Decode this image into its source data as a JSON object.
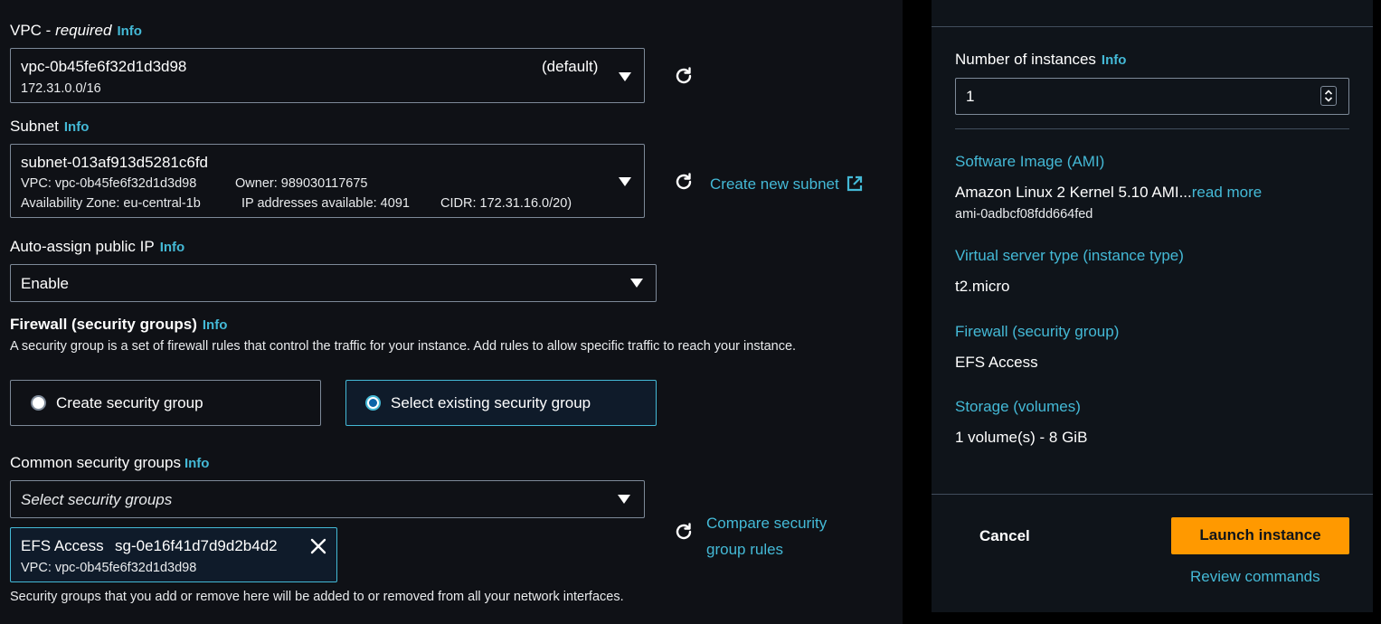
{
  "vpc": {
    "label": "VPC - ",
    "required": "required",
    "info": "Info",
    "value": "vpc-0b45fe6f32d1d3d98",
    "default_tag": "(default)",
    "cidr": "172.31.0.0/16"
  },
  "subnet": {
    "label": "Subnet",
    "info": "Info",
    "value": "subnet-013af913d5281c6fd",
    "vpc_line": "VPC: vpc-0b45fe6f32d1d3d98",
    "owner": "Owner: 989030117675",
    "az": "Availability Zone: eu-central-1b",
    "ips": "IP addresses available: 4091",
    "cidr": "CIDR: 172.31.16.0/20)",
    "create_link": "Create new subnet"
  },
  "auto_ip": {
    "label": "Auto-assign public IP",
    "info": "Info",
    "value": "Enable"
  },
  "firewall": {
    "label": "Firewall (security groups)",
    "info": "Info",
    "description": "A security group is a set of firewall rules that control the traffic for your instance. Add rules to allow specific traffic to reach your instance.",
    "option_create": "Create security group",
    "option_select": "Select existing security group"
  },
  "common_sg": {
    "label": "Common security groups",
    "info": "Info",
    "placeholder": "Select security groups",
    "compare_line1": "Compare security",
    "compare_line2": "group rules",
    "token_name": "EFS Access",
    "token_id": "sg-0e16f41d7d9d2b4d2",
    "token_vpc": "VPC: vpc-0b45fe6f32d1d3d98",
    "footnote": "Security groups that you add or remove here will be added to or removed from all your network interfaces."
  },
  "summary": {
    "instances_label": "Number of instances",
    "instances_info": "Info",
    "instances_value": "1",
    "ami_head": "Software Image (AMI)",
    "ami_value": "Amazon Linux 2 Kernel 5.10 AMI...",
    "ami_read_more": "read more",
    "ami_id": "ami-0adbcf08fdd664fed",
    "type_head": "Virtual server type (instance type)",
    "type_value": "t2.micro",
    "fw_head": "Firewall (security group)",
    "fw_value": "EFS Access",
    "storage_head": "Storage (volumes)",
    "storage_value": "1 volume(s) - 8 GiB",
    "cancel": "Cancel",
    "launch": "Launch instance",
    "review": "Review commands"
  },
  "colors": {
    "accent": "#44b9d6",
    "launch": "#ff9900",
    "border": "#7d8998"
  }
}
